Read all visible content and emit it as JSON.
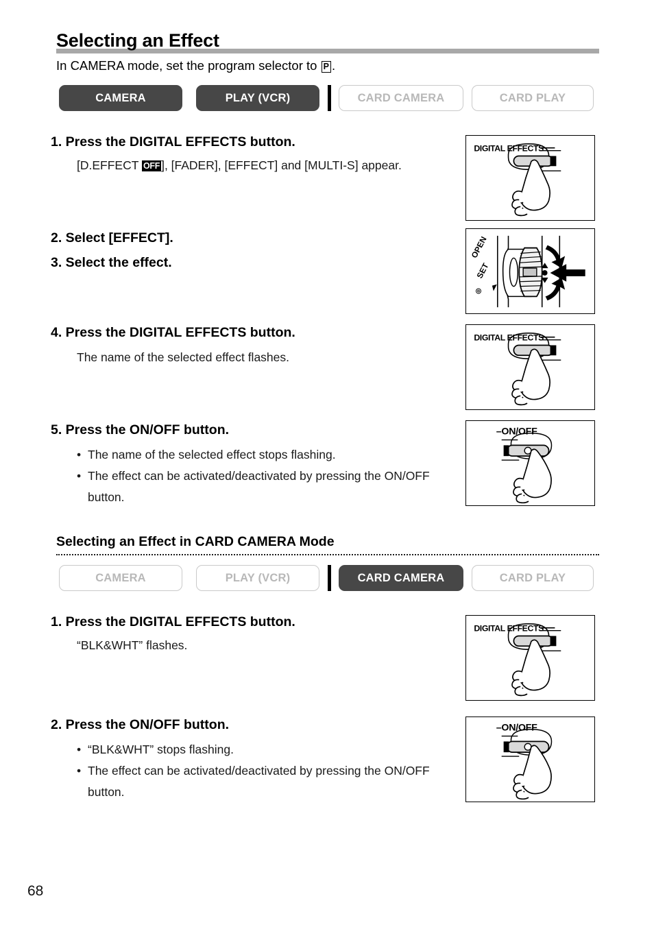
{
  "page": {
    "title": "Selecting an Effect",
    "subtitle_pre": "In CAMERA mode, set the program selector to ",
    "subtitle_icon": "P",
    "subtitle_post": ".",
    "page_number": "68",
    "accent_rule_color": "#a8a8a8",
    "pill_active_color": "#474747",
    "pill_inactive_text_color": "#b8b8b8"
  },
  "mode_row_1": {
    "pills": [
      {
        "label": "CAMERA",
        "state": "active"
      },
      {
        "label": "PLAY (VCR)",
        "state": "active"
      },
      {
        "label": "CARD CAMERA",
        "state": "inactive"
      },
      {
        "label": "CARD PLAY",
        "state": "inactive"
      }
    ]
  },
  "mode_row_2": {
    "pills": [
      {
        "label": "CAMERA",
        "state": "inactive"
      },
      {
        "label": "PLAY (VCR)",
        "state": "inactive"
      },
      {
        "label": "CARD CAMERA",
        "state": "active"
      },
      {
        "label": "CARD PLAY",
        "state": "inactive"
      }
    ]
  },
  "steps": [
    {
      "head": "1. Press the DIGITAL EFFECTS button.",
      "body_pre": "[D.EFFECT ",
      "body_badge": "OFF",
      "body_post": "], [FADER], [EFFECT] and [MULTI-S] appear."
    },
    {
      "head": "2. Select [EFFECT]."
    },
    {
      "head": "3. Select the effect."
    },
    {
      "head": "4. Press the DIGITAL EFFECTS button.",
      "body": "The name of the selected effect flashes."
    },
    {
      "head": "5. Press the ON/OFF button.",
      "bullets": [
        "The name of the selected effect stops flashing.",
        "The effect can be activated/deactivated by pressing the ON/OFF button."
      ]
    }
  ],
  "card_section": {
    "heading": "Selecting an Effect in CARD CAMERA Mode",
    "steps": [
      {
        "head": "1. Press the DIGITAL EFFECTS button.",
        "body": "“BLK&WHT” flashes."
      },
      {
        "head": "2. Press the ON/OFF button.",
        "bullets": [
          "“BLK&WHT” stops flashing.",
          "The effect can be activated/deactivated by pressing the ON/OFF button."
        ]
      }
    ]
  },
  "illustrations": [
    {
      "id": "digital-effects-1",
      "type": "button-press",
      "label": "DIGITAL EFFECTS"
    },
    {
      "id": "set-dial",
      "type": "dial",
      "labels": [
        "OPEN",
        "SET"
      ]
    },
    {
      "id": "digital-effects-2",
      "type": "button-press",
      "label": "DIGITAL EFFECTS"
    },
    {
      "id": "on-off-1",
      "type": "button-press-round",
      "label": "–ON/OFF"
    },
    {
      "id": "digital-effects-3",
      "type": "button-press",
      "label": "DIGITAL EFFECTS"
    },
    {
      "id": "on-off-2",
      "type": "button-press-round",
      "label": "–ON/OFF"
    }
  ]
}
